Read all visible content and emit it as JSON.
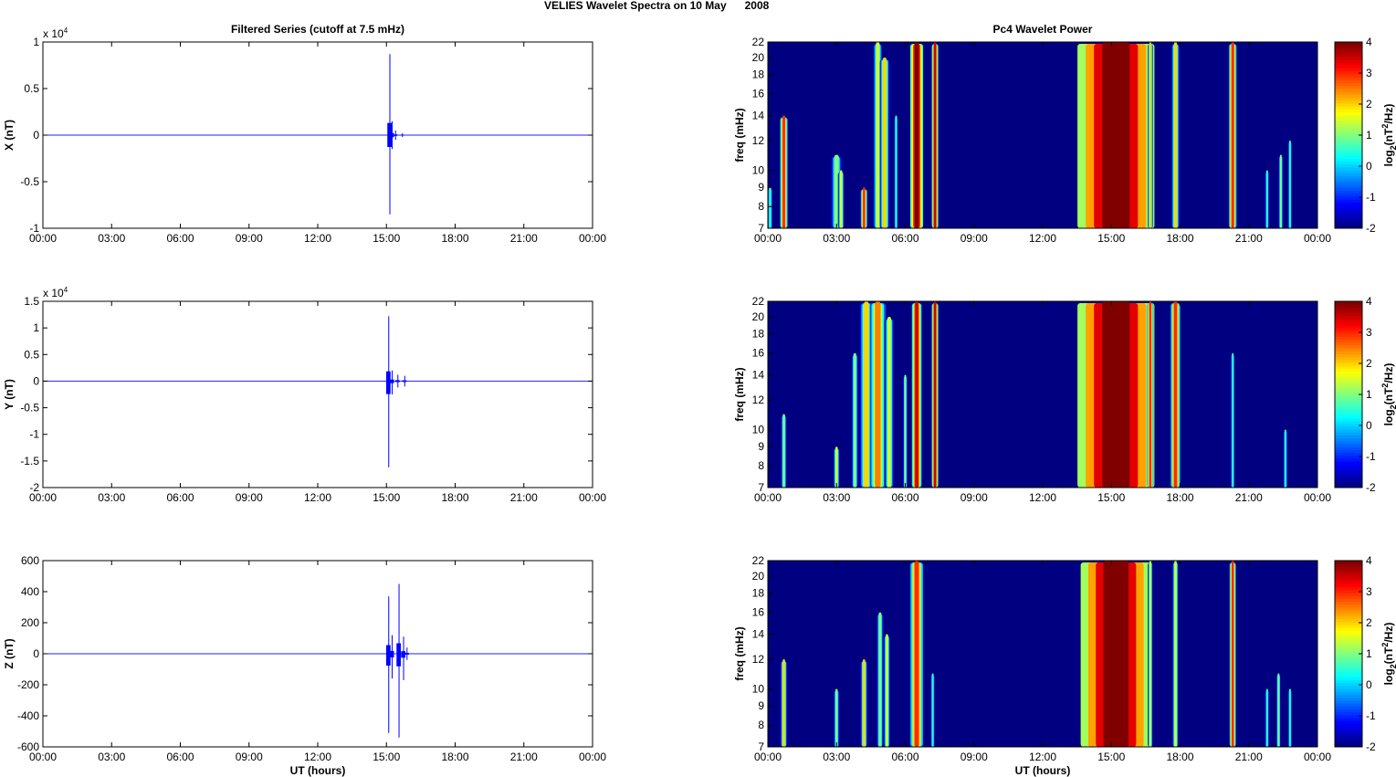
{
  "figure_title": "VELIES Wavelet Spectra on 10 May      2008",
  "chart_data": [
    {
      "type": "line",
      "title": "Filtered Series (cutoff at 7.5 mHz)",
      "ylabel": "X (nT)",
      "xlabel": "",
      "exponent_label": "x 10",
      "exponent": "4",
      "ylim": [
        -1,
        1
      ],
      "yticks": [
        "-1",
        "-0.5",
        "0",
        "0.5",
        "1"
      ],
      "yvals": [
        -1,
        -0.5,
        0,
        0.5,
        1
      ],
      "xlim": [
        0,
        24
      ],
      "xticks": [
        "00:00",
        "03:00",
        "06:00",
        "09:00",
        "12:00",
        "15:00",
        "18:00",
        "21:00",
        "00:00"
      ],
      "events": [
        {
          "t": 15.15,
          "max": 0.87,
          "min": -0.85
        },
        {
          "t": 15.25,
          "max": 0.15,
          "min": -0.15
        },
        {
          "t": 15.4,
          "max": 0.05,
          "min": -0.05
        },
        {
          "t": 15.7,
          "max": 0.02,
          "min": -0.02
        }
      ]
    },
    {
      "type": "line",
      "title": "",
      "ylabel": "Y (nT)",
      "xlabel": "",
      "exponent_label": "x 10",
      "exponent": "4",
      "ylim": [
        -2,
        1.5
      ],
      "yticks": [
        "-2",
        "-1.5",
        "-1",
        "-0.5",
        "0",
        "0.5",
        "1",
        "1.5"
      ],
      "yvals": [
        -2,
        -1.5,
        -1,
        -0.5,
        0,
        0.5,
        1,
        1.5
      ],
      "xlim": [
        0,
        24
      ],
      "xticks": [
        "00:00",
        "03:00",
        "06:00",
        "09:00",
        "12:00",
        "15:00",
        "18:00",
        "21:00",
        "00:00"
      ],
      "events": [
        {
          "t": 15.1,
          "max": 1.22,
          "min": -1.62
        },
        {
          "t": 15.25,
          "max": 0.2,
          "min": -0.25
        },
        {
          "t": 15.5,
          "max": 0.12,
          "min": -0.12
        },
        {
          "t": 15.8,
          "max": 0.1,
          "min": -0.1
        }
      ]
    },
    {
      "type": "line",
      "title": "",
      "ylabel": "Z (nT)",
      "xlabel": "UT (hours)",
      "exponent_label": "",
      "exponent": "",
      "ylim": [
        -600,
        600
      ],
      "yticks": [
        "-600",
        "-400",
        "-200",
        "0",
        "200",
        "400",
        "600"
      ],
      "yvals": [
        -600,
        -400,
        -200,
        0,
        200,
        400,
        600
      ],
      "xlim": [
        0,
        24
      ],
      "xticks": [
        "00:00",
        "03:00",
        "06:00",
        "09:00",
        "12:00",
        "15:00",
        "18:00",
        "21:00",
        "00:00"
      ],
      "events": [
        {
          "t": 15.1,
          "max": 370,
          "min": -510
        },
        {
          "t": 15.25,
          "max": 120,
          "min": -160
        },
        {
          "t": 15.55,
          "max": 450,
          "min": -540
        },
        {
          "t": 15.75,
          "max": 110,
          "min": -170
        },
        {
          "t": 15.9,
          "max": 40,
          "min": -40
        }
      ]
    },
    {
      "type": "heatmap",
      "title": "Pc4 Wavelet Power",
      "ylabel": "freq (mHz)",
      "xlabel": "",
      "colorbar_label": "log2(nT2/Hz)",
      "clim": [
        -2,
        4
      ],
      "cticks": [
        "4",
        "3",
        "2",
        "1",
        "0",
        "-1",
        "-2"
      ],
      "ylim": [
        7,
        22
      ],
      "yscale": "log",
      "yticks": [
        "22",
        "20",
        "18",
        "16",
        "14",
        "12",
        "10",
        "9",
        "8",
        "7"
      ],
      "yvals": [
        22,
        20,
        18,
        16,
        14,
        12,
        10,
        9,
        8,
        7
      ],
      "xlim": [
        0,
        24
      ],
      "xticks": [
        "00:00",
        "03:00",
        "06:00",
        "09:00",
        "12:00",
        "15:00",
        "18:00",
        "21:00",
        "00:00"
      ],
      "bursts": [
        [
          0.1,
          0.1,
          0.5,
          7,
          9
        ],
        [
          0.7,
          0.12,
          3,
          7,
          14
        ],
        [
          3.0,
          0.2,
          1,
          7,
          11
        ],
        [
          3.2,
          0.1,
          1.5,
          7,
          10
        ],
        [
          4.2,
          0.1,
          3,
          7,
          9
        ],
        [
          4.8,
          0.15,
          1.5,
          7,
          22
        ],
        [
          5.1,
          0.15,
          2,
          7,
          20
        ],
        [
          5.6,
          0.08,
          0.5,
          7,
          14
        ],
        [
          6.5,
          0.2,
          4,
          7,
          22
        ],
        [
          7.3,
          0.1,
          3.5,
          7,
          22
        ],
        [
          15.2,
          1.2,
          4.5,
          7,
          22
        ],
        [
          16.7,
          0.08,
          2,
          7,
          22
        ],
        [
          17.8,
          0.12,
          2,
          7,
          22
        ],
        [
          20.3,
          0.12,
          3,
          7,
          22
        ],
        [
          21.8,
          0.08,
          0.5,
          7,
          10
        ],
        [
          22.4,
          0.08,
          1,
          7,
          11
        ],
        [
          22.8,
          0.08,
          0.5,
          7,
          12
        ]
      ]
    },
    {
      "type": "heatmap",
      "title": "",
      "ylabel": "freq (mHz)",
      "xlabel": "",
      "colorbar_label": "log2(nT2/Hz)",
      "clim": [
        -2,
        4
      ],
      "cticks": [
        "4",
        "3",
        "2",
        "1",
        "0",
        "-1",
        "-2"
      ],
      "ylim": [
        7,
        22
      ],
      "yscale": "log",
      "yticks": [
        "22",
        "20",
        "18",
        "16",
        "14",
        "12",
        "10",
        "9",
        "8",
        "7"
      ],
      "yvals": [
        22,
        20,
        18,
        16,
        14,
        12,
        10,
        9,
        8,
        7
      ],
      "xlim": [
        0,
        24
      ],
      "xticks": [
        "00:00",
        "03:00",
        "06:00",
        "09:00",
        "12:00",
        "15:00",
        "18:00",
        "21:00",
        "00:00"
      ],
      "bursts": [
        [
          0.7,
          0.1,
          1,
          7,
          11
        ],
        [
          3.0,
          0.1,
          1.5,
          7,
          9
        ],
        [
          3.8,
          0.12,
          1,
          7,
          16
        ],
        [
          4.3,
          0.2,
          2,
          7,
          22
        ],
        [
          4.8,
          0.25,
          2.5,
          7,
          22
        ],
        [
          5.3,
          0.15,
          1.5,
          7,
          20
        ],
        [
          6.0,
          0.08,
          1,
          7,
          14
        ],
        [
          6.5,
          0.15,
          3.5,
          7,
          22
        ],
        [
          7.3,
          0.1,
          3.5,
          7,
          22
        ],
        [
          15.2,
          1.2,
          4.5,
          7,
          22
        ],
        [
          16.7,
          0.1,
          3,
          7,
          22
        ],
        [
          17.8,
          0.15,
          3,
          7,
          22
        ],
        [
          20.3,
          0.08,
          0.5,
          7,
          16
        ],
        [
          22.6,
          0.08,
          0.5,
          7,
          10
        ]
      ]
    },
    {
      "type": "heatmap",
      "title": "",
      "ylabel": "freq (mHz)",
      "xlabel": "UT (hours)",
      "colorbar_label": "log2(nT2/Hz)",
      "clim": [
        -2,
        4
      ],
      "cticks": [
        "4",
        "3",
        "2",
        "1",
        "0",
        "-1",
        "-2"
      ],
      "ylim": [
        7,
        22
      ],
      "yscale": "log",
      "yticks": [
        "22",
        "20",
        "18",
        "16",
        "14",
        "12",
        "10",
        "9",
        "8",
        "7"
      ],
      "yvals": [
        22,
        20,
        18,
        16,
        14,
        12,
        10,
        9,
        8,
        7
      ],
      "xlim": [
        0,
        24
      ],
      "xticks": [
        "00:00",
        "03:00",
        "06:00",
        "09:00",
        "12:00",
        "15:00",
        "18:00",
        "21:00",
        "00:00"
      ],
      "bursts": [
        [
          0.7,
          0.1,
          2,
          7,
          12
        ],
        [
          3.0,
          0.1,
          1,
          7,
          10
        ],
        [
          4.2,
          0.1,
          2,
          7,
          12
        ],
        [
          4.9,
          0.12,
          1,
          7,
          16
        ],
        [
          5.2,
          0.1,
          1.5,
          7,
          14
        ],
        [
          6.5,
          0.2,
          3,
          7,
          22
        ],
        [
          7.2,
          0.08,
          0.5,
          7,
          11
        ],
        [
          15.2,
          1.1,
          4.5,
          7,
          22
        ],
        [
          16.7,
          0.08,
          1.5,
          7,
          22
        ],
        [
          17.8,
          0.1,
          1.5,
          7,
          22
        ],
        [
          20.3,
          0.1,
          3,
          7,
          22
        ],
        [
          21.8,
          0.08,
          0.5,
          7,
          10
        ],
        [
          22.3,
          0.08,
          1,
          7,
          11
        ],
        [
          22.8,
          0.08,
          0.5,
          7,
          10
        ]
      ]
    }
  ]
}
